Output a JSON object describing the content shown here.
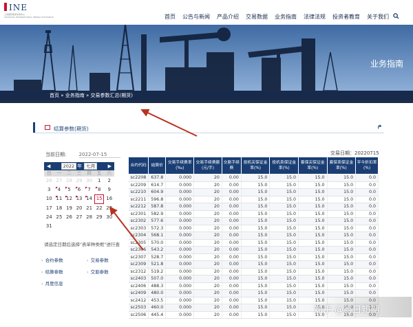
{
  "logo": {
    "text": "INE",
    "subtitle": "上海国际能源交易中心",
    "subtitle_en": "SHANGHAI INTERNATIONAL ENERGY EXCHANGE"
  },
  "nav": [
    "首页",
    "公告与新闻",
    "产品介绍",
    "交易数据",
    "业务指南",
    "法律法规",
    "投资者教育",
    "关于我们"
  ],
  "banner": {
    "title": "业务指南"
  },
  "breadcrumb": "首页 » 业务指南 » 交易参数汇总(期货)",
  "panel": {
    "title": "结算参数(期货)"
  },
  "date": {
    "label": "当前日期:",
    "value": "2022-07-15"
  },
  "calendar": {
    "year": "2022",
    "month": "七月",
    "weekdays": [
      "日",
      "一",
      "二",
      "三",
      "四",
      "五",
      "六"
    ],
    "weeks": [
      [
        "26",
        "27",
        "28",
        "29",
        "30",
        "1",
        "2"
      ],
      [
        "3",
        "4",
        "5",
        "6",
        "7",
        "8",
        "9"
      ],
      [
        "10",
        "11",
        "12",
        "13",
        "14",
        "15",
        "16"
      ],
      [
        "17",
        "18",
        "19",
        "20",
        "21",
        "22",
        "23"
      ],
      [
        "24",
        "25",
        "26",
        "27",
        "28",
        "29",
        "30"
      ],
      [
        "31",
        "",
        "",
        "",
        "",
        "",
        ""
      ]
    ],
    "note": "请选定日期后选择\"表单种类框\"进行查"
  },
  "links": [
    "合约参数",
    "交易参数",
    "结算参数",
    "交割参数",
    "月度信息"
  ],
  "table": {
    "caption": "交易日期：20220715",
    "headers": [
      "合约代码",
      "结算价",
      "交易手续费率(‰)",
      "交易手续费额(元/手)",
      "交割手续费",
      "投机买保证金率(%)",
      "投机卖保证金率(%)",
      "套保买保证金率(%)",
      "套保卖保证金率(%)",
      "平今折扣率(%)"
    ],
    "rows": [
      [
        "sc2208",
        "637.8",
        "0.000",
        "20",
        "0.00",
        "15.0",
        "15.0",
        "15.0",
        "15.0",
        "0.0"
      ],
      [
        "sc2209",
        "614.7",
        "0.000",
        "20",
        "0.00",
        "15.0",
        "15.0",
        "15.0",
        "15.0",
        "0.0"
      ],
      [
        "sc2210",
        "604.9",
        "0.000",
        "20",
        "0.00",
        "15.0",
        "15.0",
        "15.0",
        "15.0",
        "0.0"
      ],
      [
        "sc2211",
        "596.8",
        "0.000",
        "20",
        "0.00",
        "15.0",
        "15.0",
        "15.0",
        "15.0",
        "0.0"
      ],
      [
        "sc2212",
        "587.8",
        "0.000",
        "20",
        "0.00",
        "15.0",
        "15.0",
        "15.0",
        "15.0",
        "0.0"
      ],
      [
        "sc2301",
        "582.9",
        "0.000",
        "20",
        "0.00",
        "15.0",
        "15.0",
        "15.0",
        "15.0",
        "0.0"
      ],
      [
        "sc2302",
        "577.6",
        "0.000",
        "20",
        "0.00",
        "15.0",
        "15.0",
        "15.0",
        "15.0",
        "0.0"
      ],
      [
        "sc2303",
        "572.3",
        "0.000",
        "20",
        "0.00",
        "15.0",
        "15.0",
        "15.0",
        "15.0",
        "0.0"
      ],
      [
        "sc2304",
        "568.1",
        "0.000",
        "20",
        "0.00",
        "15.0",
        "15.0",
        "15.0",
        "15.0",
        "0.0"
      ],
      [
        "sc2305",
        "570.0",
        "0.000",
        "20",
        "0.00",
        "15.0",
        "15.0",
        "15.0",
        "15.0",
        "0.0"
      ],
      [
        "sc2306",
        "543.2",
        "0.000",
        "20",
        "0.00",
        "15.0",
        "15.0",
        "15.0",
        "15.0",
        "0.0"
      ],
      [
        "sc2307",
        "528.7",
        "0.000",
        "20",
        "0.00",
        "15.0",
        "15.0",
        "15.0",
        "15.0",
        "0.0"
      ],
      [
        "sc2309",
        "521.8",
        "0.000",
        "20",
        "0.00",
        "15.0",
        "15.0",
        "15.0",
        "15.0",
        "0.0"
      ],
      [
        "sc2312",
        "519.2",
        "0.000",
        "20",
        "0.00",
        "15.0",
        "15.0",
        "15.0",
        "15.0",
        "0.0"
      ],
      [
        "sc2403",
        "507.0",
        "0.000",
        "20",
        "0.00",
        "15.0",
        "15.0",
        "15.0",
        "15.0",
        "0.0"
      ],
      [
        "sc2406",
        "488.3",
        "0.000",
        "20",
        "0.00",
        "15.0",
        "15.0",
        "15.0",
        "15.0",
        "0.0"
      ],
      [
        "sc2409",
        "480.0",
        "0.000",
        "20",
        "0.00",
        "15.0",
        "15.0",
        "15.0",
        "15.0",
        "0.0"
      ],
      [
        "sc2412",
        "453.5",
        "0.000",
        "20",
        "0.00",
        "15.0",
        "15.0",
        "15.0",
        "15.0",
        "0.0"
      ],
      [
        "sc2503",
        "460.0",
        "0.000",
        "20",
        "0.00",
        "15.0",
        "15.0",
        "15.0",
        "15.0",
        "0.0"
      ],
      [
        "sc2506",
        "445.4",
        "0.000",
        "20",
        "0.00",
        "15.0",
        "15.0",
        "15.0",
        "15.0",
        "0.0"
      ]
    ]
  },
  "watermark": "知乎 @当日知期",
  "colors": {
    "navy": "#1a3e74",
    "red": "#c8102e",
    "arrow": "#b8321f"
  }
}
